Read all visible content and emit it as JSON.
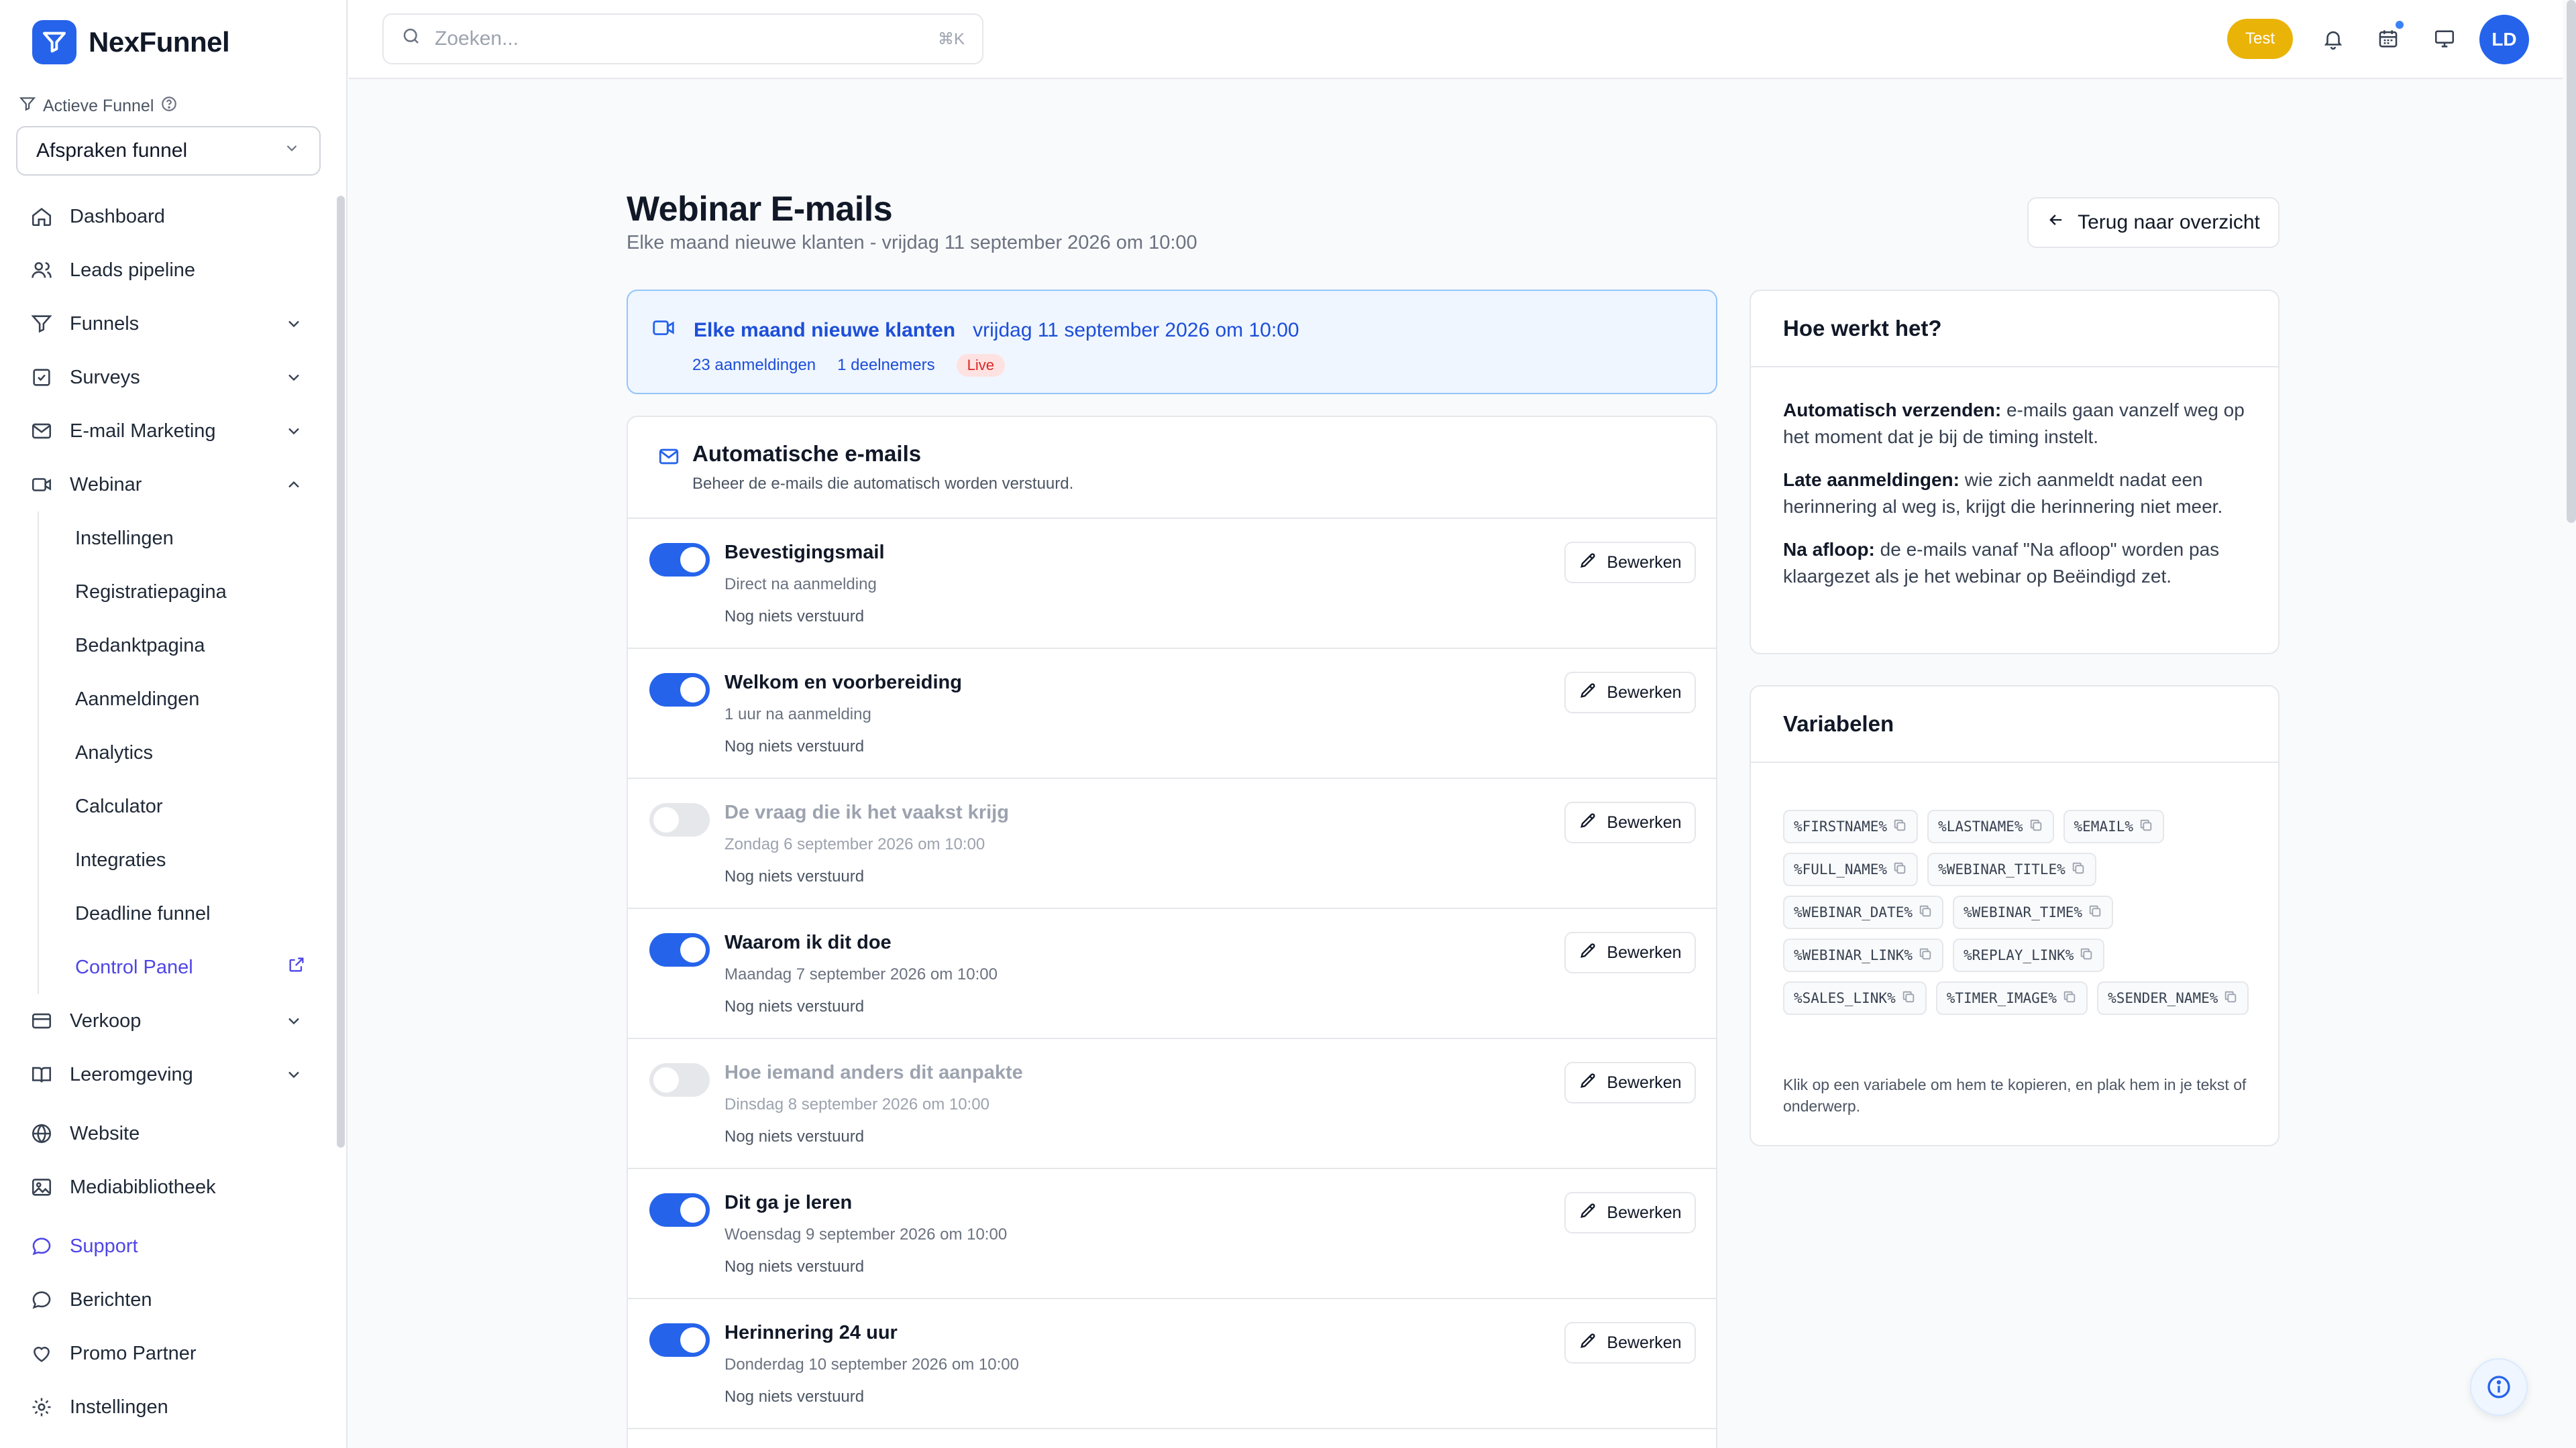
{
  "app": {
    "name": "NexFunnel"
  },
  "sidebar": {
    "funnel_label": "Actieve Funnel",
    "funnel_selected": "Afspraken funnel",
    "items": [
      {
        "label": "Dashboard",
        "icon": "home-icon"
      },
      {
        "label": "Leads pipeline",
        "icon": "users-icon"
      },
      {
        "label": "Funnels",
        "icon": "funnel-icon"
      },
      {
        "label": "Surveys",
        "icon": "checkbox-icon"
      },
      {
        "label": "E-mail Marketing",
        "icon": "mail-icon"
      },
      {
        "label": "Webinar",
        "icon": "video-icon"
      }
    ],
    "webinar_sub": [
      "Instellingen",
      "Registratiepagina",
      "Bedanktpagina",
      "Aanmeldingen",
      "Analytics",
      "Calculator",
      "Integraties",
      "Deadline funnel",
      "Control Panel"
    ],
    "items_bottom": [
      {
        "label": "Verkoop",
        "icon": "card-icon"
      },
      {
        "label": "Leeromgeving",
        "icon": "book-icon"
      },
      {
        "label": "Website",
        "icon": "globe-icon"
      },
      {
        "label": "Mediabibliotheek",
        "icon": "image-icon"
      },
      {
        "label": "Support",
        "icon": "chat-icon"
      },
      {
        "label": "Berichten",
        "icon": "chat-icon"
      },
      {
        "label": "Promo Partner",
        "icon": "heart-icon"
      },
      {
        "label": "Instellingen",
        "icon": "gear-icon"
      }
    ]
  },
  "topbar": {
    "search_placeholder": "Zoeken...",
    "search_shortcut": "⌘K",
    "badge": "Test",
    "avatar_initials": "LD"
  },
  "page": {
    "title": "Webinar E-mails",
    "subtitle": "Elke maand nieuwe klanten - vrijdag 11 september 2026 om 10:00",
    "back_label": "Terug naar overzicht"
  },
  "webinar": {
    "name": "Elke maand nieuwe klanten",
    "date": "vrijdag 11 september 2026 om 10:00",
    "registrations": "23 aanmeldingen",
    "participants": "1 deelnemers",
    "status": "Live"
  },
  "emails": {
    "title": "Automatische e-mails",
    "description": "Beheer de e-mails die automatisch worden verstuurd.",
    "edit_label": "Bewerken",
    "rows": [
      {
        "title": "Bevestigingsmail",
        "timing": "Direct na aanmelding",
        "status": "Nog niets verstuurd",
        "enabled": true
      },
      {
        "title": "Welkom en voorbereiding",
        "timing": "1 uur na aanmelding",
        "status": "Nog niets verstuurd",
        "enabled": true
      },
      {
        "title": "De vraag die ik het vaakst krijg",
        "timing": "Zondag 6 september 2026 om 10:00",
        "status": "Nog niets verstuurd",
        "enabled": false
      },
      {
        "title": "Waarom ik dit doe",
        "timing": "Maandag 7 september 2026 om 10:00",
        "status": "Nog niets verstuurd",
        "enabled": true
      },
      {
        "title": "Hoe iemand anders dit aanpakte",
        "timing": "Dinsdag 8 september 2026 om 10:00",
        "status": "Nog niets verstuurd",
        "enabled": false
      },
      {
        "title": "Dit ga je leren",
        "timing": "Woensdag 9 september 2026 om 10:00",
        "status": "Nog niets verstuurd",
        "enabled": true
      },
      {
        "title": "Herinnering 24 uur",
        "timing": "Donderdag 10 september 2026 om 10:00",
        "status": "Nog niets verstuurd",
        "enabled": true
      }
    ]
  },
  "how_it_works": {
    "title": "Hoe werkt het?",
    "items": [
      {
        "label": "Automatisch verzenden:",
        "text": "e-mails gaan vanzelf weg op het moment dat je bij de timing instelt."
      },
      {
        "label": "Late aanmeldingen:",
        "text": "wie zich aanmeldt nadat een herinnering al weg is, krijgt die herinnering niet meer."
      },
      {
        "label": "Na afloop:",
        "text": "de e-mails vanaf \"Na afloop\" worden pas klaargezet als je het webinar op Beëindigd zet."
      }
    ]
  },
  "variables": {
    "title": "Variabelen",
    "list": [
      "%FIRSTNAME%",
      "%LASTNAME%",
      "%EMAIL%",
      "%FULL_NAME%",
      "%WEBINAR_TITLE%",
      "%WEBINAR_DATE%",
      "%WEBINAR_TIME%",
      "%WEBINAR_LINK%",
      "%REPLAY_LINK%",
      "%SALES_LINK%",
      "%TIMER_IMAGE%",
      "%SENDER_NAME%"
    ],
    "note": "Klik op een variabele om hem te kopieren, en plak hem in je tekst of onderwerp."
  },
  "colors": {
    "accent": "#2563eb",
    "live": "#dc2626",
    "badge": "#eab308",
    "link": "#4f46e5"
  }
}
